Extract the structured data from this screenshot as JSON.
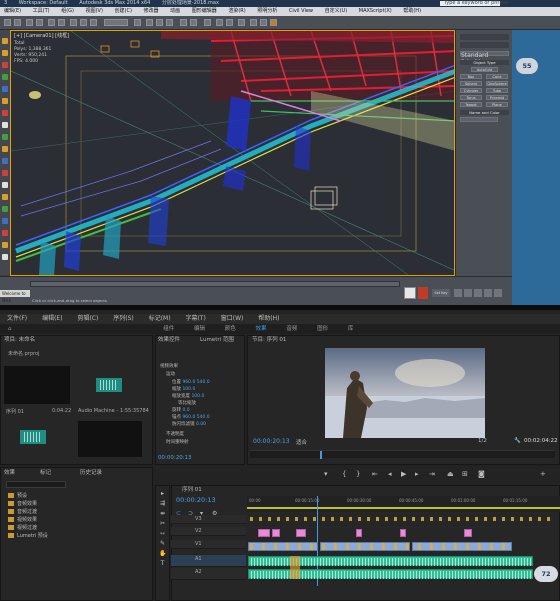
{
  "max": {
    "title_segments": [
      "3",
      "Workspace: Default",
      "Autodesk 3ds Max 2014 x64",
      "分层处理场景-2018.max",
      "Type a keyword or phrase"
    ],
    "menu": [
      "编辑(E)",
      "工具(T)",
      "组(G)",
      "视图(V)",
      "创建(C)",
      "修改器",
      "动画",
      "图形编辑器",
      "渲染(R)",
      "照明分析",
      "Civil View",
      "自定义(U)",
      "MAXScript(X)",
      "帮助(H)"
    ],
    "viewport_label": "[+] [Camera01] [线框]",
    "viewport_stats": [
      "Total",
      "Polys: 1,388,361",
      "Verts: 950,241",
      "FPS: 4.000"
    ],
    "command_panel": {
      "object_type_title": "Object Type",
      "dropdown": "Standard Primitives",
      "autogrid": "AutoGrid",
      "primitives": [
        "Box",
        "Cone",
        "Sphere",
        "GeoSphere",
        "Cylinder",
        "Tube",
        "Torus",
        "Pyramid",
        "Teapot",
        "Plane"
      ],
      "name_color_title": "Name and Color"
    },
    "fps_badge": "55",
    "maxscript_label": "Welcome to MAX",
    "prompt": "Click or click-and-drag to select objects",
    "set_key": "Set Key"
  },
  "premiere": {
    "menu": [
      "文件(F)",
      "编辑(E)",
      "剪辑(C)",
      "序列(S)",
      "标记(M)",
      "字幕(T)",
      "窗口(W)",
      "帮助(H)"
    ],
    "workspaces": [
      "组件",
      "编辑",
      "颜色",
      "效果",
      "音频",
      "图形",
      "库"
    ],
    "active_workspace": "效果",
    "project": {
      "tab": "项目: 未命名",
      "filename": "未命名.prproj",
      "items": [
        {
          "name": "序列 01",
          "duration": "0:04:22"
        },
        {
          "name": "Audio Machine -...",
          "duration": "1:55:35784"
        },
        {
          "name": "",
          "duration": ""
        },
        {
          "name": "",
          "duration": ""
        }
      ]
    },
    "effects": {
      "tabs": [
        "效果",
        "标记",
        "历史记录"
      ],
      "bins": [
        "预设",
        "音频效果",
        "音频过渡",
        "视频效果",
        "视频过渡",
        "Lumetri 预设"
      ]
    },
    "effect_controls": {
      "tabs": [
        "效果控件",
        "Lumetri 范围"
      ],
      "rows": [
        {
          "label": "视频效果",
          "value": ""
        },
        {
          "label": "运动",
          "value": ""
        },
        {
          "label": "位置",
          "value": "960.0  540.0"
        },
        {
          "label": "缩放",
          "value": "100.0"
        },
        {
          "label": "缩放宽度",
          "value": "100.0"
        },
        {
          "label": "等比缩放",
          "value": ""
        },
        {
          "label": "旋转",
          "value": "0.0"
        },
        {
          "label": "锚点",
          "value": "960.0  540.0"
        },
        {
          "label": "防闪烁滤镜",
          "value": "0.00"
        },
        {
          "label": "不透明度",
          "value": ""
        },
        {
          "label": "时间重映射",
          "value": ""
        }
      ],
      "timecode": "00:00:20:13"
    },
    "program": {
      "tab": "节目: 序列 01",
      "timecode": "00:00:20:13",
      "fit": "适合",
      "scale": "1/2",
      "duration": "00:02:04:22"
    },
    "timeline": {
      "tab": "序列 01",
      "timecode": "00:00:20:13",
      "ruler": [
        "00:00",
        "00:00:15:00",
        "00:00:30:00",
        "00:00:45:00",
        "00:01:00:00",
        "00:01:15:00"
      ],
      "tracks": [
        "V3",
        "V2",
        "V1",
        "A1",
        "A2"
      ]
    },
    "speed_badge": "72"
  },
  "colors": {
    "max_bg": "#3b3f45",
    "viewport_bg": "#2b2f35",
    "pr_accent": "#3f9de8",
    "clip_pink": "#e88ad8",
    "clip_blue": "#8da9d6",
    "clip_green": "#2fbf95"
  }
}
